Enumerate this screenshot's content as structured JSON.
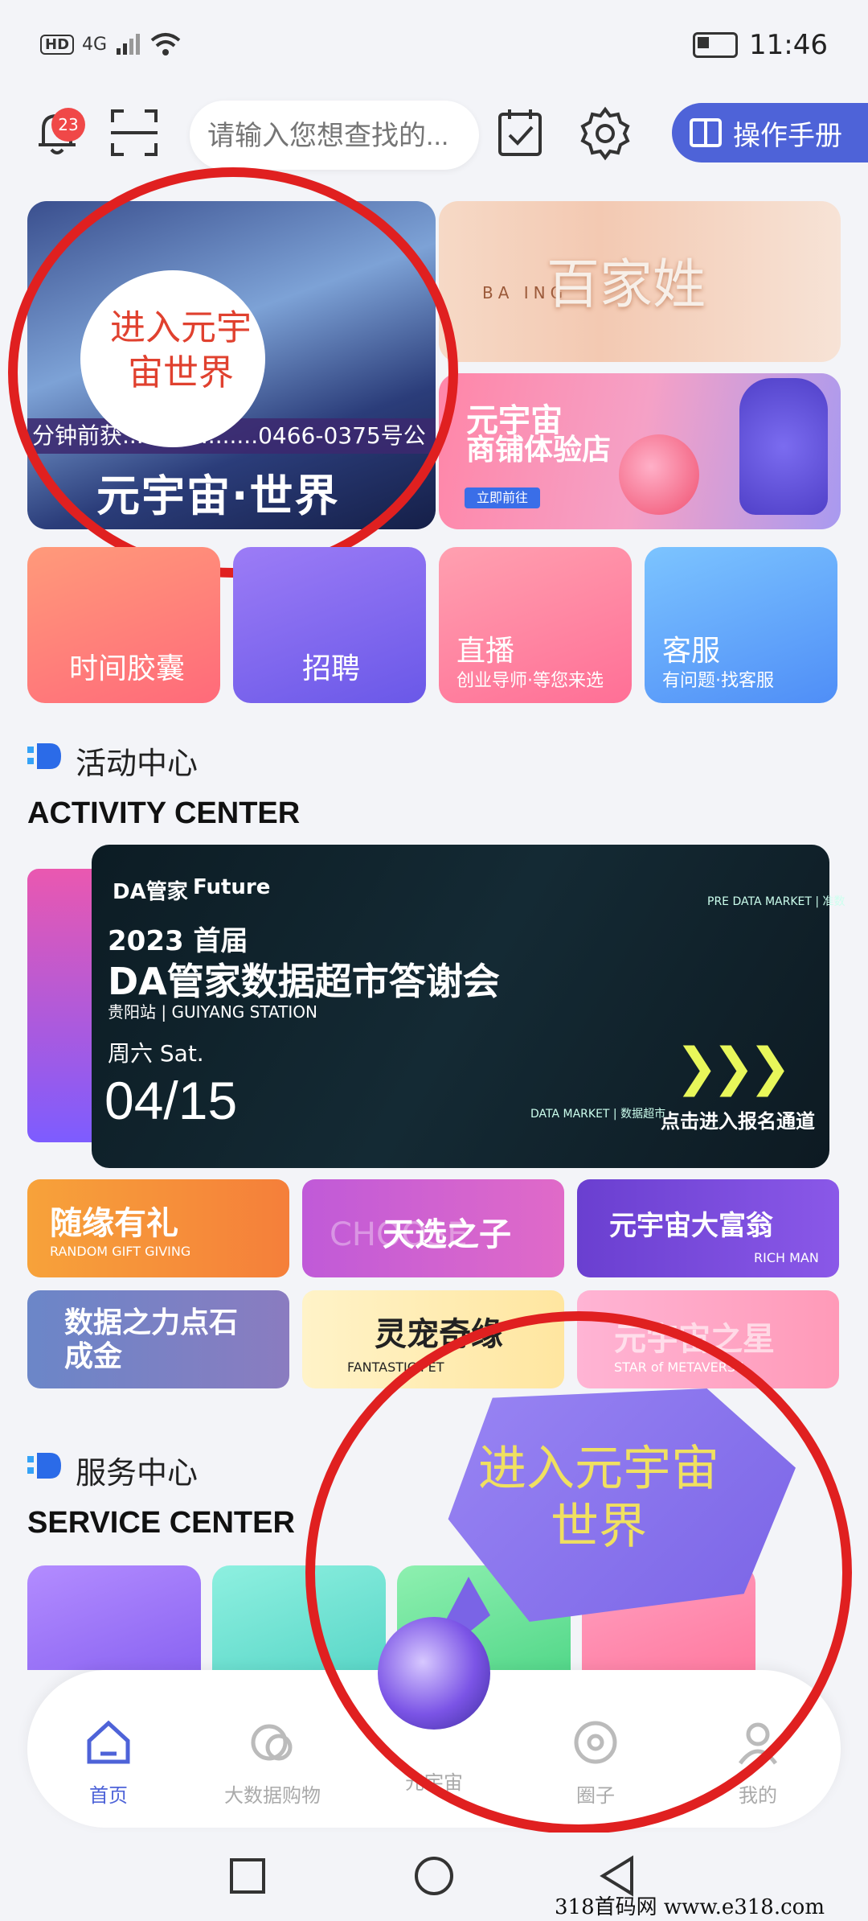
{
  "status_bar": {
    "network": "HD",
    "signal": "4G",
    "time": "11:46"
  },
  "header": {
    "notification_count": "23",
    "search_placeholder": "请输入您想查找的...",
    "manual_label": "操作手册"
  },
  "top_cards": {
    "metaverse_tag": "分钟前获...................0466-0375号公",
    "metaverse_title": "元宇宙·世界",
    "baijiaxing_title": "百家姓",
    "baijiaxing_sub": "BA                   ING",
    "shop_title": "元宇宙",
    "shop_sub": "商铺体验店",
    "shop_btn": "立即前往"
  },
  "annotations": {
    "bubble_top": "进入元宇宙世界",
    "bubble_bottom": "进入元宇宙世界"
  },
  "quick_tiles": [
    {
      "label": "时间胶囊",
      "sub": ""
    },
    {
      "label": "招聘",
      "sub": ""
    },
    {
      "label": "直播",
      "sub": "创业导师·等您来选"
    },
    {
      "label": "客服",
      "sub": "有问题·找客服"
    }
  ],
  "activity": {
    "title_zh": "活动中心",
    "title_en": "ACTIVITY CENTER",
    "banner": {
      "brand": "DA管家",
      "partner": "Future",
      "year": "2023 首届",
      "title": "DA管家数据超市答谢会",
      "station": "贵阳站 | GUIYANG STATION",
      "day": "周六  Sat.",
      "date": "04/15",
      "cta": "点击进入报名通道",
      "top_label": "PRE DATA MARKET | 准数",
      "bottom_label": "DATA MARKET | 数据超市"
    },
    "grid": [
      {
        "main": "随缘有礼",
        "sub": "RANDOM GIFT GIVING"
      },
      {
        "main": "天选之子",
        "sub": "CHOOSE"
      },
      {
        "main": "元宇宙大富翁",
        "sub": "RICH MAN"
      },
      {
        "main": "数据之力点石成金",
        "sub": ""
      },
      {
        "main": "灵宠奇缘",
        "sub": "FANTASTIC PET"
      },
      {
        "main": "元宇宙之星",
        "sub": "STAR of METAVERSE"
      }
    ]
  },
  "service": {
    "title_zh": "服务中心",
    "title_en": "SERVICE CENTER"
  },
  "bottom_nav": [
    {
      "label": "首页"
    },
    {
      "label": "大数据购物"
    },
    {
      "label": "元宇宙"
    },
    {
      "label": "圈子"
    },
    {
      "label": "我的"
    }
  ],
  "watermark": "318首码网    www.e318.com",
  "colors": {
    "accent": "#4e63d8",
    "annotation_red": "#e02020"
  }
}
